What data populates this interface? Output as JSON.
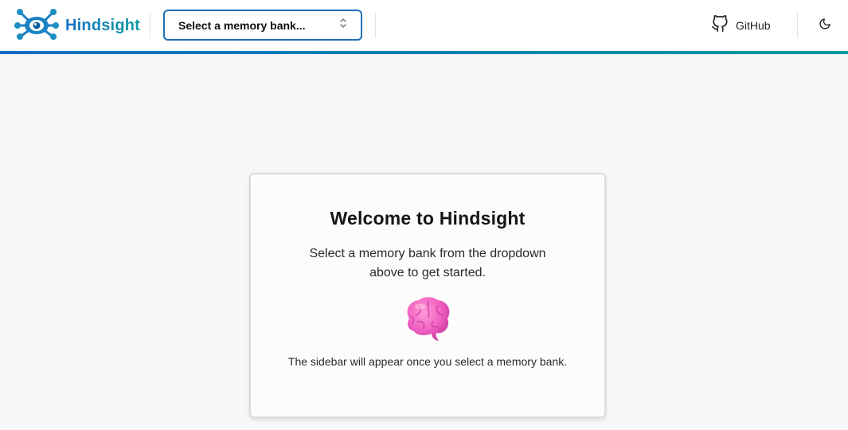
{
  "header": {
    "app_name": "Hindsight",
    "bank_select": {
      "label": "Select a memory bank..."
    },
    "github_label": "GitHub"
  },
  "welcome": {
    "title": "Welcome to Hindsight",
    "subtitle": "Select a memory bank from the dropdown above to get started.",
    "note": "The sidebar will appear once you select a memory bank.",
    "emoji": "brain-emoji"
  },
  "colors": {
    "brand_blue": "#1572c8",
    "brand_teal": "#0e9aa0",
    "select_border": "#1f6fb8",
    "page_bg": "#f7f7f7"
  }
}
